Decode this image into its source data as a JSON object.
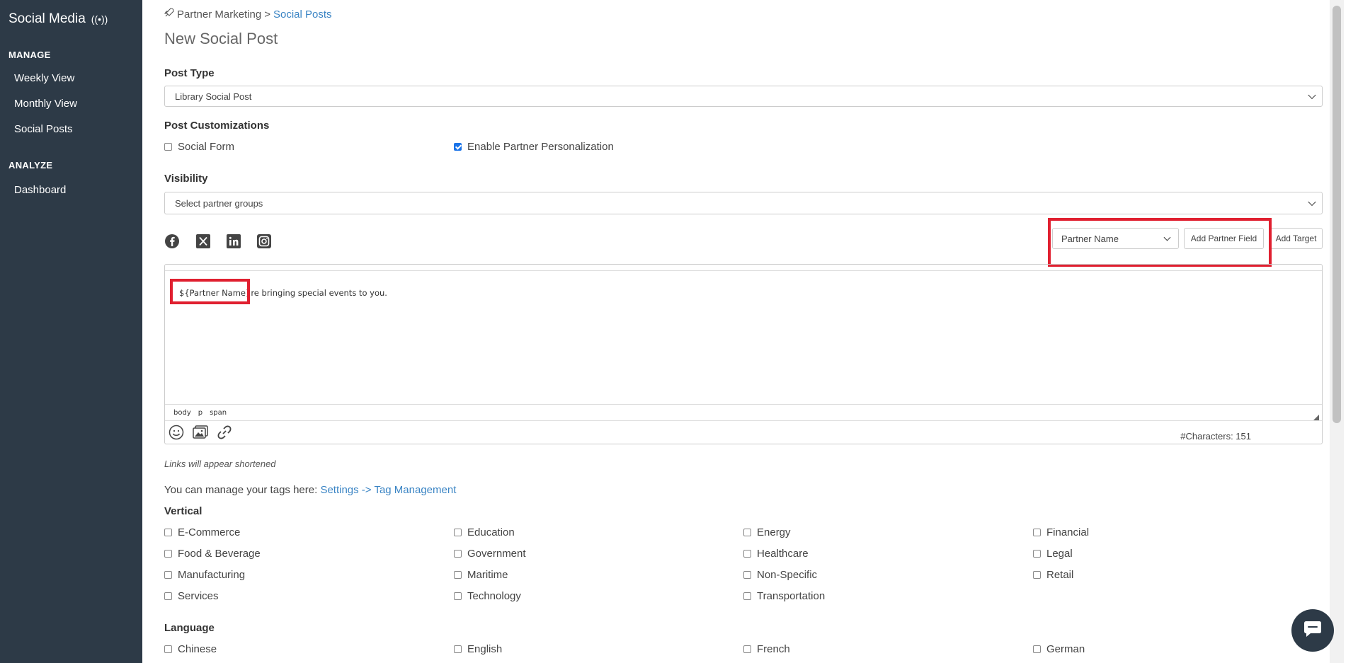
{
  "sidebar": {
    "title": "Social Media",
    "title_icon": "broadcast-icon",
    "manage_heading": "MANAGE",
    "manage_items": [
      "Weekly View",
      "Monthly View",
      "Social Posts"
    ],
    "analyze_heading": "ANALYZE",
    "analyze_items": [
      "Dashboard"
    ]
  },
  "breadcrumb": {
    "parent": "Partner Marketing",
    "separator": ">",
    "current": "Social Posts"
  },
  "page_title": "New Social Post",
  "post_type": {
    "label": "Post Type",
    "value": "Library Social Post"
  },
  "customizations": {
    "label": "Post Customizations",
    "social_form": {
      "label": "Social Form",
      "checked": false
    },
    "partner_personalization": {
      "label": "Enable Partner Personalization",
      "checked": true
    }
  },
  "visibility": {
    "label": "Visibility",
    "placeholder": "Select partner groups"
  },
  "social_networks": [
    "facebook",
    "x",
    "linkedin",
    "instagram"
  ],
  "partner_field": {
    "selected": "Partner Name",
    "add_button": "Add Partner Field",
    "add_target_button": "Add Target"
  },
  "editor": {
    "token": "${Partner Name}",
    "text": "re bringing special events to you.",
    "status_path": [
      "body",
      "p",
      "span"
    ],
    "char_count": "#Characters: 151"
  },
  "note": "Links will appear shortened",
  "tags": {
    "prefix": "You can manage your tags here: ",
    "link": "Settings -> Tag Management"
  },
  "vertical": {
    "label": "Vertical",
    "options": [
      "E-Commerce",
      "Education",
      "Energy",
      "Financial",
      "Food & Beverage",
      "Government",
      "Healthcare",
      "Legal",
      "Manufacturing",
      "Maritime",
      "Non-Specific",
      "Retail",
      "Services",
      "Technology",
      "Transportation"
    ]
  },
  "language": {
    "label": "Language",
    "options": [
      "Chinese",
      "English",
      "French",
      "German"
    ]
  },
  "colors": {
    "sidebar_bg": "#2d3a47",
    "link": "#3a84c4",
    "highlight": "#e02030",
    "checkbox_checked": "#1a73e8"
  }
}
